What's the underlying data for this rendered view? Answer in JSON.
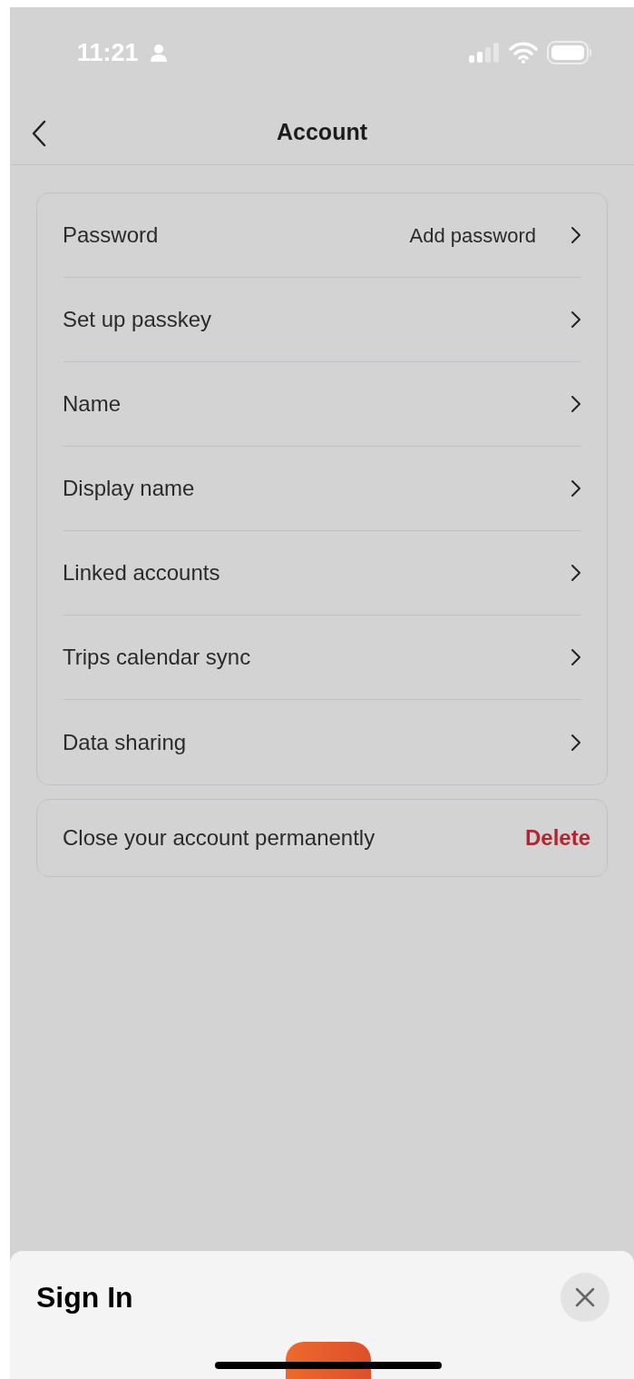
{
  "status_bar": {
    "time": "11:21"
  },
  "nav": {
    "title": "Account"
  },
  "settings": [
    {
      "label": "Password",
      "value": "Add password"
    },
    {
      "label": "Set up passkey"
    },
    {
      "label": "Name"
    },
    {
      "label": "Display name"
    },
    {
      "label": "Linked accounts"
    },
    {
      "label": "Trips calendar sync"
    },
    {
      "label": "Data sharing"
    }
  ],
  "close_account": {
    "label": "Close your account permanently",
    "action": "Delete"
  },
  "sheet": {
    "title": "Sign In"
  }
}
